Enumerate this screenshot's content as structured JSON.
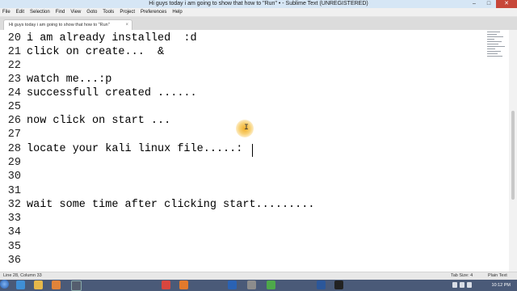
{
  "window": {
    "title": "Hi guys today i am going to show that how to \"Run\" • - Sublime Text (UNREGISTERED)",
    "minimize": "–",
    "maximize": "□",
    "close": "✕"
  },
  "menu": [
    "File",
    "Edit",
    "Selection",
    "Find",
    "View",
    "Goto",
    "Tools",
    "Project",
    "Preferences",
    "Help"
  ],
  "tab": {
    "label": "Hi guys today i am going to show that how to \"Run\"",
    "close": "×"
  },
  "editor": {
    "lines": [
      {
        "num": "20",
        "text": "i am already installed  :d"
      },
      {
        "num": "21",
        "text": "click on create...  &"
      },
      {
        "num": "22",
        "text": ""
      },
      {
        "num": "23",
        "text": "watch me...:p"
      },
      {
        "num": "24",
        "text": "successfull created ......"
      },
      {
        "num": "25",
        "text": ""
      },
      {
        "num": "26",
        "text": "now click on start ..."
      },
      {
        "num": "27",
        "text": ""
      },
      {
        "num": "28",
        "text": "locate your kali linux file.....:"
      },
      {
        "num": "29",
        "text": ""
      },
      {
        "num": "30",
        "text": ""
      },
      {
        "num": "31",
        "text": ""
      },
      {
        "num": "32",
        "text": "wait some time after clicking start........."
      },
      {
        "num": "33",
        "text": ""
      },
      {
        "num": "34",
        "text": ""
      },
      {
        "num": "35",
        "text": ""
      },
      {
        "num": "36",
        "text": ""
      }
    ]
  },
  "status": {
    "position": "Line 28, Column 33",
    "tab_size": "Tab Size: 4",
    "syntax": "Plain Text"
  },
  "taskbar": {
    "time": "10:12 PM",
    "icons": [
      "start-orb-icon",
      "ie-icon",
      "folder-icon",
      "media-icon",
      "app-icon",
      "chrome-icon",
      "firefox-icon",
      "virtualbox-icon",
      "sublime-icon",
      "green-app-icon",
      "word-icon",
      "cmd-icon"
    ]
  },
  "colors": {
    "titlebar": "#d6e6f5",
    "close_button": "#c7473a",
    "taskbar": "#4a5a78",
    "mouse_highlight": "#f0aa1e"
  }
}
